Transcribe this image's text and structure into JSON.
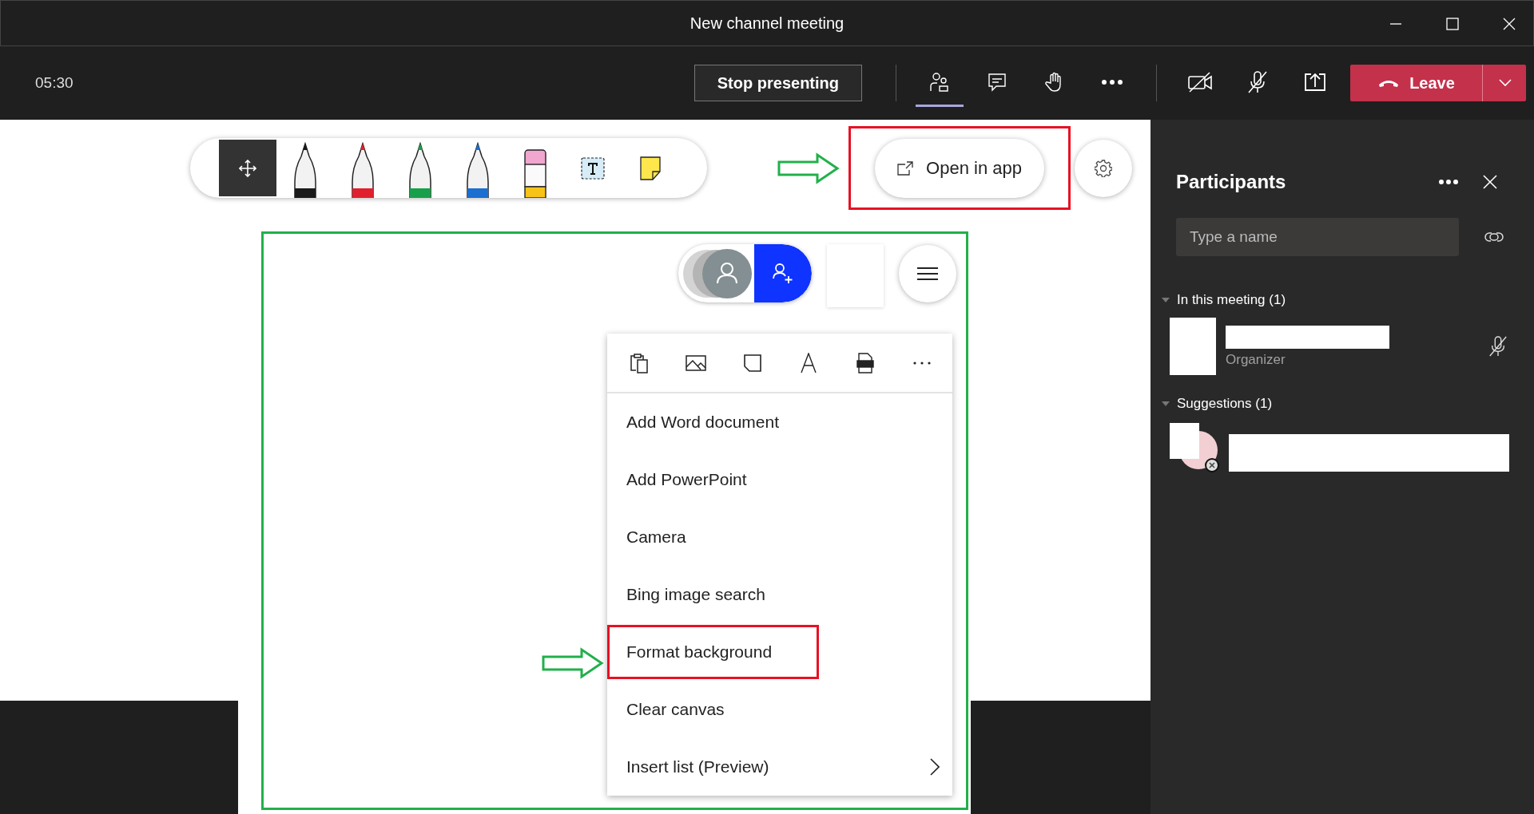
{
  "window": {
    "title": "New channel meeting"
  },
  "meeting_bar": {
    "timer": "05:30",
    "stop_button": "Stop presenting",
    "tools": [
      {
        "kind": "people",
        "selected": true
      },
      {
        "kind": "chat",
        "selected": false
      },
      {
        "kind": "hand",
        "selected": false
      },
      {
        "kind": "more",
        "selected": false
      }
    ],
    "media": [
      {
        "kind": "camera-off"
      },
      {
        "kind": "mic-off"
      },
      {
        "kind": "share"
      }
    ],
    "leave_button": "Leave"
  },
  "whiteboard": {
    "tools": [
      {
        "kind": "move",
        "selected": true
      },
      {
        "kind": "pen",
        "color": "#1a1a1a",
        "selected": false
      },
      {
        "kind": "pen",
        "color": "#e0202e",
        "selected": false
      },
      {
        "kind": "pen",
        "color": "#17a04a",
        "selected": false
      },
      {
        "kind": "pen",
        "color": "#1a6fd0",
        "selected": false
      },
      {
        "kind": "eraser",
        "selected": false
      },
      {
        "kind": "text",
        "selected": false
      },
      {
        "kind": "note",
        "selected": false
      }
    ],
    "open_button": {
      "label": "Open in app",
      "highlighted": true
    },
    "board": {
      "highlighted": true,
      "menu": {
        "icons": [
          {
            "kind": "paste"
          },
          {
            "kind": "image"
          },
          {
            "kind": "note"
          },
          {
            "kind": "text"
          },
          {
            "kind": "pdf"
          },
          {
            "kind": "more"
          }
        ],
        "items": [
          {
            "label": "Add Word document",
            "highlighted": false,
            "submenu": false
          },
          {
            "label": "Add PowerPoint",
            "highlighted": false,
            "submenu": false
          },
          {
            "label": "Camera",
            "highlighted": false,
            "submenu": false
          },
          {
            "label": "Bing image search",
            "highlighted": false,
            "submenu": false
          },
          {
            "label": "Format background",
            "highlighted": true,
            "submenu": false
          },
          {
            "label": "Clear canvas",
            "highlighted": false,
            "submenu": false
          },
          {
            "label": "Insert list (Preview)",
            "highlighted": false,
            "submenu": true
          }
        ]
      }
    }
  },
  "participants": {
    "title": "Participants",
    "search": {
      "placeholder": "Type a name"
    },
    "sections": [
      {
        "title": "In this meeting (1)",
        "expanded": true,
        "people": [
          {
            "kind": "member",
            "role": "Organizer",
            "muted": true
          }
        ]
      },
      {
        "title": "Suggestions (1)",
        "expanded": true,
        "people": [
          {
            "kind": "suggestion"
          }
        ]
      }
    ]
  }
}
